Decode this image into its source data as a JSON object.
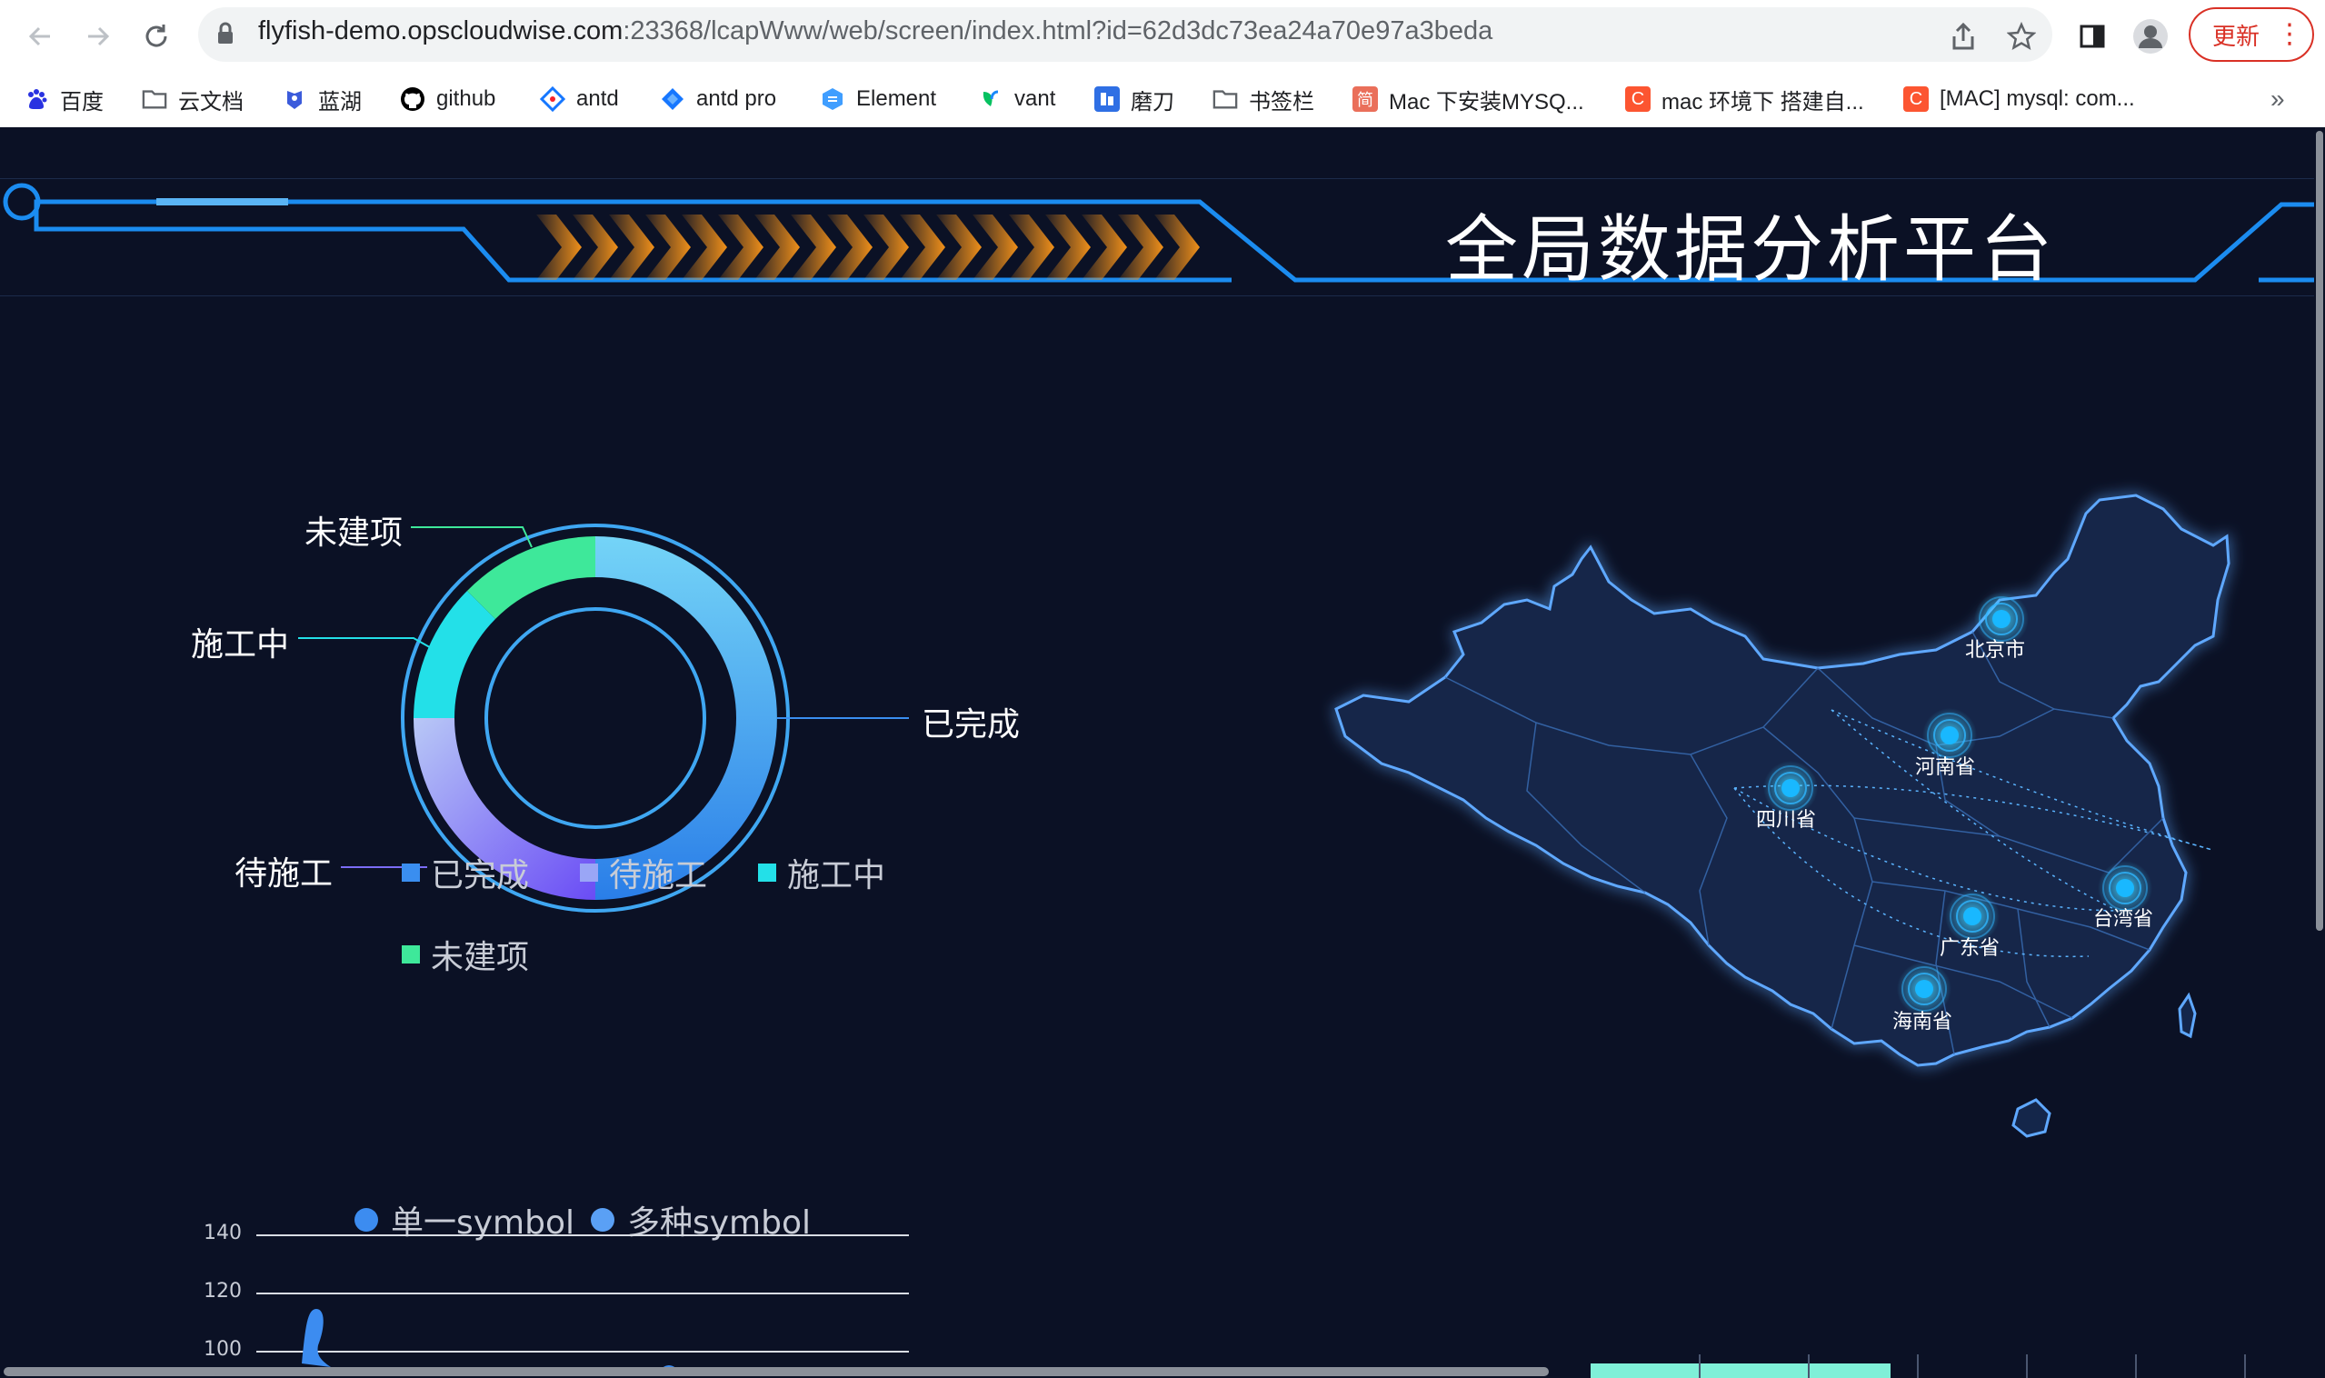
{
  "browser": {
    "url_host": "flyfish-demo.opscloudwise.com",
    "url_rest": ":23368/lcapWww/web/screen/index.html?id=62d3dc73ea24a70e97a3beda",
    "update_label": "更新",
    "bookmarks": [
      {
        "label": "百度",
        "icon": "baidu-icon",
        "color": "#2932e1"
      },
      {
        "label": "云文档",
        "icon": "folder-icon",
        "color": "#5f6368"
      },
      {
        "label": "蓝湖",
        "icon": "lanhu-icon",
        "color": "#3b5bdb"
      },
      {
        "label": "github",
        "icon": "github-icon",
        "color": "#000000"
      },
      {
        "label": "antd",
        "icon": "antd-icon",
        "color": "#1677ff"
      },
      {
        "label": "antd pro",
        "icon": "antd-pro-icon",
        "color": "#1677ff"
      },
      {
        "label": "Element",
        "icon": "element-icon",
        "color": "#409eff"
      },
      {
        "label": "vant",
        "icon": "vant-icon",
        "color": "#07c160"
      },
      {
        "label": "磨刀",
        "icon": "modao-icon",
        "color": "#2f6fe4"
      },
      {
        "label": "书签栏",
        "icon": "folder-icon",
        "color": "#5f6368"
      },
      {
        "label": "Mac 下安装MYSQ...",
        "icon": "jianshu-icon",
        "color": "#ea6f5a"
      },
      {
        "label": "mac 环境下 搭建自...",
        "icon": "csdn-icon",
        "color": "#fc5531"
      },
      {
        "label": "[MAC] mysql: com...",
        "icon": "csdn-icon",
        "color": "#fc5531"
      }
    ],
    "overflow_label": "»"
  },
  "dashboard": {
    "title": "全局数据分析平台",
    "colors": {
      "background": "#0b1125",
      "frame": "#1677e6",
      "accent_orange": "#f0901a"
    }
  },
  "donut": {
    "labels": {
      "completed": "已完成",
      "pending": "待施工",
      "in_progress": "施工中",
      "not_built": "未建项"
    },
    "legend": [
      "已完成",
      "待施工",
      "施工中",
      "未建项"
    ],
    "colors": {
      "completed": "#3a8ef0",
      "pending": "#7b6cf6",
      "in_progress": "#23e0e8",
      "not_built": "#3ee89a"
    }
  },
  "chart_data": {
    "type": "line",
    "series": [
      {
        "name": "单一symbol",
        "color": "#3c8cf0"
      },
      {
        "name": "多种symbol",
        "color": "#5aa0f5"
      }
    ],
    "y_ticks": [
      "140",
      "120",
      "100"
    ],
    "ylim_visible": [
      100,
      140
    ]
  },
  "map": {
    "cities": [
      {
        "name": "北京市"
      },
      {
        "name": "河南省"
      },
      {
        "name": "四川省"
      },
      {
        "name": "台湾省"
      },
      {
        "name": "广东省"
      },
      {
        "name": "海南省"
      }
    ]
  }
}
